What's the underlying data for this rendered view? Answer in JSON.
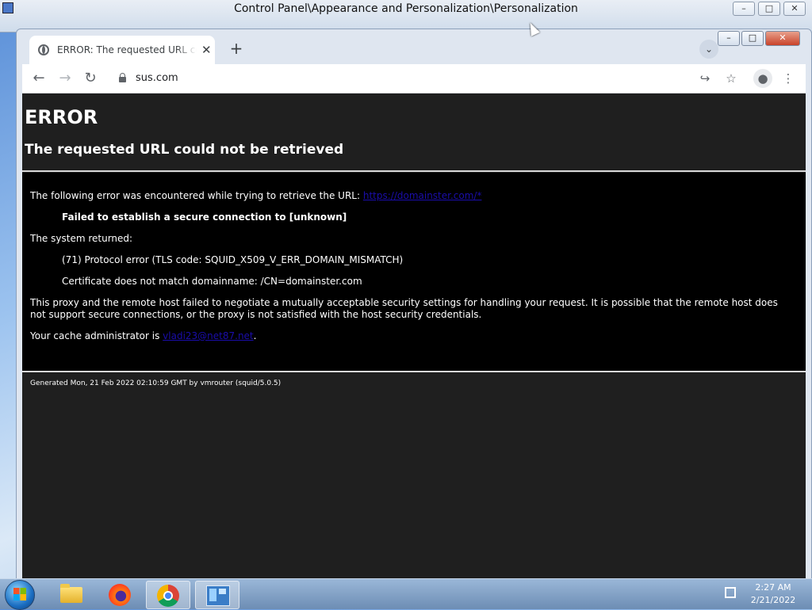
{
  "background_window": {
    "title": "Control Panel\\Appearance and Personalization\\Personalization",
    "controls": [
      "–",
      "□",
      "✕"
    ]
  },
  "browser": {
    "tab": {
      "title": "ERROR: The requested URL could not be retrieved",
      "close": "✕"
    },
    "new_tab": "+",
    "tab_search": "⌄",
    "window_controls": [
      "–",
      "□",
      "✕"
    ],
    "toolbar": {
      "back": "←",
      "forward": "→",
      "reload": "↻",
      "url": "sus.com",
      "share": "↪",
      "bookmark": "☆",
      "profile": "●",
      "menu": "⋮"
    }
  },
  "page": {
    "heading": "ERROR",
    "subheading": "The requested URL could not be retrieved",
    "error_intro": "The following error was encountered while trying to retrieve the URL: ",
    "error_url": "https://domainster.com/*",
    "error_title": "Failed to establish a secure connection to [unknown]",
    "system_returned": "The system returned:",
    "protocol_error": "(71) Protocol error (TLS code: SQUID_X509_V_ERR_DOMAIN_MISMATCH)",
    "cert_mismatch": "Certificate does not match domainname: /CN=domainster.com",
    "description": "This proxy and the remote host failed to negotiate a mutually acceptable security settings for handling your request. It is possible that the remote host does not support secure connections, or the proxy is not satisfied with the host security credentials.",
    "admin_prefix": "Your cache administrator is ",
    "admin_email": "vladi23@net87.net",
    "admin_suffix": ".",
    "footer": "Generated Mon, 21 Feb 2022 02:10:59 GMT by vmrouter (squid/5.0.5)"
  },
  "taskbar": {
    "items": [
      "Windows Explorer",
      "Firefox",
      "Google Chrome",
      "Control Panel"
    ],
    "clock_time": "2:27 AM",
    "clock_date": "2/21/2022"
  },
  "colors": {
    "page_bg": "#1f1f1f",
    "message_bg": "#000000",
    "link": "#1a0dab",
    "taskbar": "#7d9dc4"
  }
}
